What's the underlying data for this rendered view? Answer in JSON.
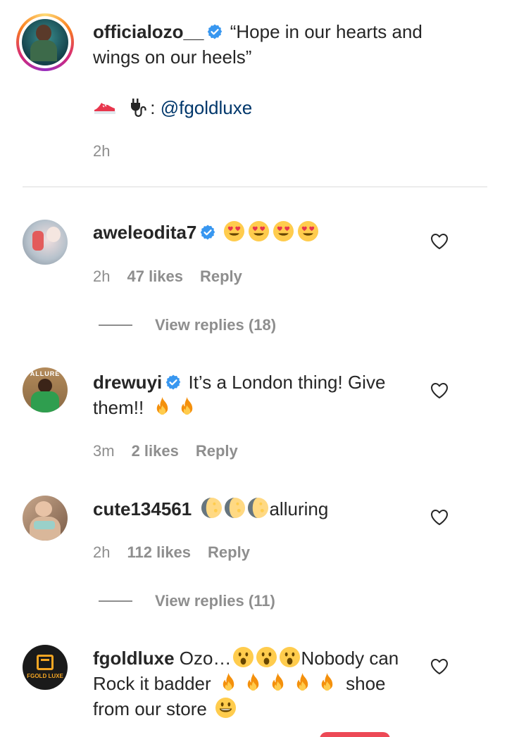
{
  "caption": {
    "username": "officialozo__",
    "text_line1": "“Hope in our hearts and",
    "text_line2": "wings on our heels”",
    "credit_mention": "@fgoldluxe",
    "credit_sep": ":",
    "time": "2h"
  },
  "comments": [
    {
      "username": "aweleodita7",
      "time": "2h",
      "likes": "47 likes",
      "reply": "Reply",
      "view_replies": "View replies (18)"
    },
    {
      "username": "drewuyi",
      "text_line1": "It’s a London thing! Give",
      "text_line2": "them!!",
      "time": "3m",
      "likes": "2 likes",
      "reply": "Reply"
    },
    {
      "username": "cute134561",
      "text": "alluring",
      "time": "2h",
      "likes": "112 likes",
      "reply": "Reply",
      "view_replies": "View replies (11)"
    },
    {
      "username": "fgoldluxe",
      "text_line1a": "Ozo…",
      "text_line1b": "Nobody can",
      "text_line2a": "Rock it badder",
      "text_line2b": "shoe",
      "text_line3": "from our store",
      "avatar_text": "FGOLD LUXE"
    }
  ],
  "colors": {
    "accent_blue": "#3897f0",
    "link": "#00376b",
    "muted": "#8e8e8e",
    "text": "#262626"
  }
}
